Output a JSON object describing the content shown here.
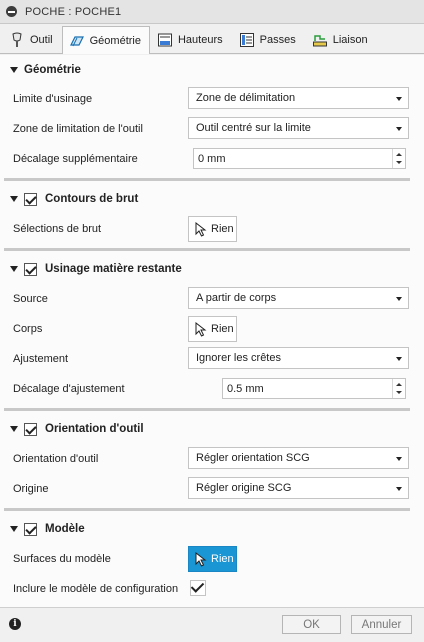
{
  "window": {
    "title": "POCHE : POCHE1"
  },
  "tabs": [
    {
      "label": "Outil",
      "icon": "tool-icon",
      "active": false
    },
    {
      "label": "Géométrie",
      "icon": "geometry-icon",
      "active": true
    },
    {
      "label": "Hauteurs",
      "icon": "heights-icon",
      "active": false
    },
    {
      "label": "Passes",
      "icon": "passes-icon",
      "active": false
    },
    {
      "label": "Liaison",
      "icon": "linking-icon",
      "active": false
    }
  ],
  "sections": {
    "geometrie": {
      "title": "Géométrie",
      "limite_label": "Limite d'usinage",
      "limite_value": "Zone de délimitation",
      "zone_label": "Zone de limitation de l'outil",
      "zone_value": "Outil centré sur la limite",
      "decalage_label": "Décalage supplémentaire",
      "decalage_value": "0 mm"
    },
    "contours": {
      "title": "Contours de brut",
      "checked": true,
      "selections_label": "Sélections de brut",
      "selections_button": "Rien"
    },
    "restante": {
      "title": "Usinage matière restante",
      "checked": true,
      "source_label": "Source",
      "source_value": "A partir de corps",
      "corps_label": "Corps",
      "corps_button": "Rien",
      "ajustement_label": "Ajustement",
      "ajustement_value": "Ignorer les crêtes",
      "decalage_label": "Décalage d'ajustement",
      "decalage_value": "0.5 mm"
    },
    "orientation": {
      "title": "Orientation d'outil",
      "checked": true,
      "orientation_label": "Orientation d'outil",
      "orientation_value": "Régler orientation SCG",
      "origine_label": "Origine",
      "origine_value": "Régler origine SCG"
    },
    "modele": {
      "title": "Modèle",
      "checked": true,
      "surfaces_label": "Surfaces du modèle",
      "surfaces_button": "Rien",
      "inclure_label": "Inclure le modèle de configuration",
      "inclure_checked": true
    }
  },
  "footer": {
    "info": "i",
    "ok": "OK",
    "cancel": "Annuler"
  },
  "colors": {
    "active_selection": "#1a96d4",
    "panel": "#fbfbfb",
    "chrome": "#f0f0f0"
  }
}
